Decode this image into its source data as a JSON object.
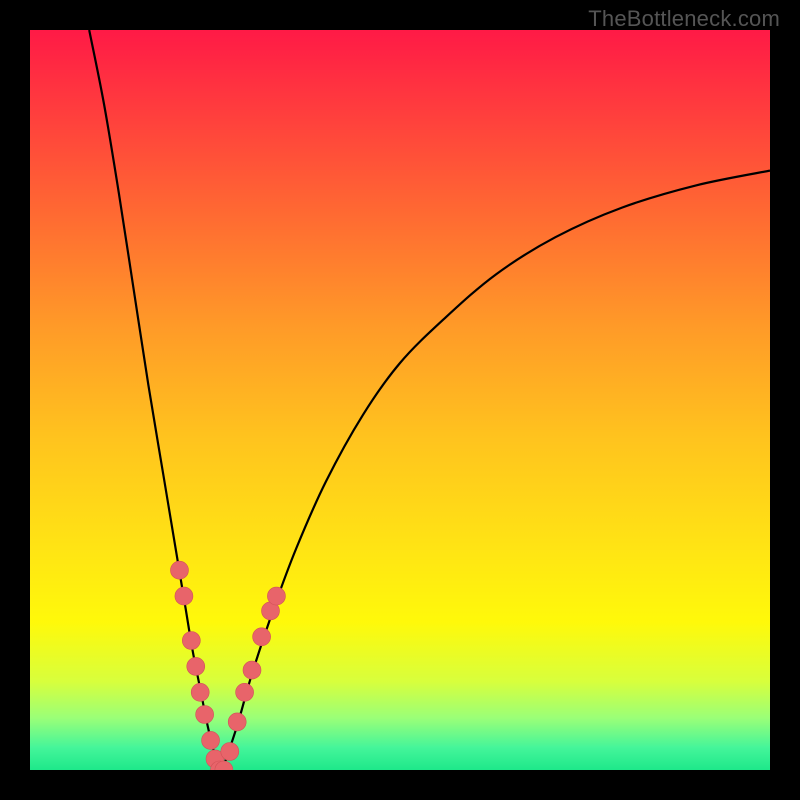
{
  "watermark": "TheBottleneck.com",
  "chart_data": {
    "type": "line",
    "title": "",
    "xlabel": "",
    "ylabel": "",
    "xlim": [
      0,
      100
    ],
    "ylim": [
      0,
      100
    ],
    "grid": false,
    "legend": false,
    "background_gradient": [
      "#ff1a46",
      "#ff9a28",
      "#ffe414",
      "#1ee88a"
    ],
    "curve_left": {
      "x": [
        8,
        10,
        12,
        14,
        16,
        18,
        20,
        21,
        22,
        23,
        24,
        25,
        26
      ],
      "y": [
        100,
        90,
        78,
        65,
        52,
        40,
        28,
        22,
        16,
        11,
        6,
        2,
        0
      ]
    },
    "curve_right": {
      "x": [
        26,
        28,
        30,
        33,
        36,
        40,
        45,
        50,
        56,
        63,
        71,
        80,
        90,
        100
      ],
      "y": [
        0,
        6,
        13,
        22,
        30,
        39,
        48,
        55,
        61,
        67,
        72,
        76,
        79,
        81
      ]
    },
    "markers": {
      "x": [
        20.2,
        20.8,
        21.8,
        22.4,
        23.0,
        23.6,
        24.4,
        25.0,
        25.6,
        26.2,
        27.0,
        28.0,
        29.0,
        30.0,
        31.3,
        32.5,
        33.3
      ],
      "y": [
        27.0,
        23.5,
        17.5,
        14.0,
        10.5,
        7.5,
        4.0,
        1.5,
        0.0,
        0.0,
        2.5,
        6.5,
        10.5,
        13.5,
        18.0,
        21.5,
        23.5
      ]
    }
  }
}
